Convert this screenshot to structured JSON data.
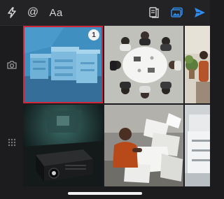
{
  "toolbar": {
    "items": [
      {
        "icon": "bolt-icon"
      },
      {
        "icon": "at-sign-icon",
        "glyph": "@"
      },
      {
        "icon": "text-format-icon",
        "glyph": "Aa"
      }
    ],
    "right_items": [
      {
        "icon": "sticky-note-icon"
      },
      {
        "icon": "photo-library-icon",
        "active": true
      },
      {
        "icon": "send-icon"
      }
    ],
    "accent": "#2f8cf0"
  },
  "sidebar": {
    "items": [
      {
        "icon": "camera-icon"
      },
      {
        "icon": "grid-dots-icon"
      }
    ]
  },
  "gallery": {
    "selected_index": 0,
    "selection_color": "#d0283a",
    "tiles": [
      {
        "name": "office-printers",
        "selected": true,
        "badge": "1"
      },
      {
        "name": "meeting-table-topdown"
      },
      {
        "name": "office-plants-partial"
      },
      {
        "name": "projector-on-stage"
      },
      {
        "name": "man-with-paper-pile"
      },
      {
        "name": "printer-partial"
      }
    ]
  }
}
